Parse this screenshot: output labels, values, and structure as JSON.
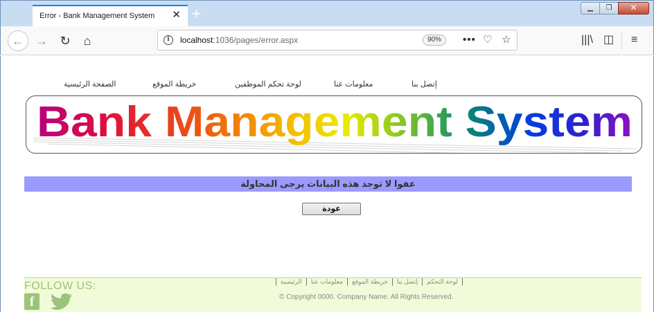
{
  "browser": {
    "tab_title": "Error - Bank Management System",
    "tab_close": "✕",
    "new_tab": "+",
    "window_min": "▁",
    "window_max": "❐",
    "window_close": "✕",
    "back": "←",
    "forward": "→",
    "reload": "↻",
    "home": "⌂",
    "url_host": "localhost",
    "url_rest": ":1036/pages/error.aspx",
    "zoom": "90%",
    "page_actions": "•••",
    "pocket_icon": "♡",
    "star_icon": "☆",
    "library_icon": "|||\\",
    "sidebar_icon": "◫",
    "menu_icon": "≡"
  },
  "top_nav": {
    "home": "الصفحة الرئيسية",
    "sitemap": "خريطة الموقع",
    "employee_panel": "لوحة تحكم الموظفين",
    "about": "معلومات عنا",
    "contact": "إتصل بنا"
  },
  "banner": {
    "title": "Bank Management System",
    "colors": [
      "#c0007a",
      "#e8143c",
      "#f07a00",
      "#f5c800",
      "#c8e000",
      "#6ab82a",
      "#009a6e",
      "#0050c8",
      "#0030ff",
      "#4010d0",
      "#8a10c0"
    ]
  },
  "error": {
    "message": "عفوا لا توجد هذه البيانات يرجى المحاولة"
  },
  "back_button": "عودة",
  "footer": {
    "follow_us": "FOLLOW US:",
    "facebook": "f",
    "links": [
      "لوحة التحكم",
      "إتصل بنا",
      "خريطة الموقع",
      "معلومات عنا",
      "الرئيسية"
    ],
    "copyright": "© Copyright 0000. Company Name. All Rights Reserved."
  }
}
